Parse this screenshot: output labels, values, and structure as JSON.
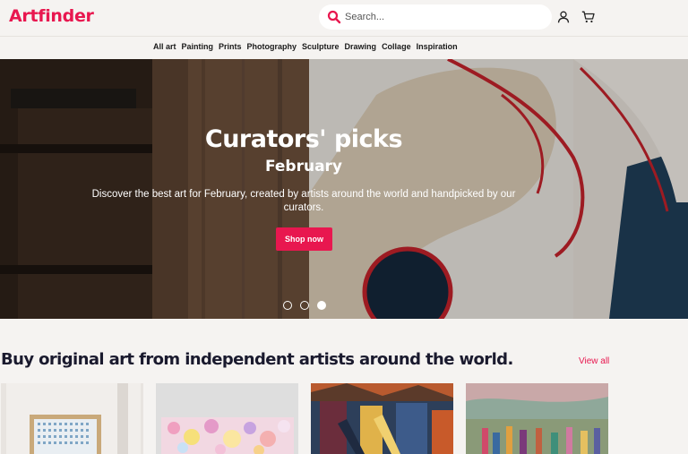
{
  "header": {
    "logo": "Artfinder",
    "search_placeholder": "Search...",
    "icons": [
      "search-icon",
      "user-icon",
      "cart-icon"
    ],
    "brand_color": "#e8174f"
  },
  "nav": {
    "items": [
      "All art",
      "Painting",
      "Prints",
      "Photography",
      "Sculpture",
      "Drawing",
      "Collage",
      "Inspiration"
    ]
  },
  "hero": {
    "title": "Curators' picks",
    "subtitle": "February",
    "description": "Discover the best art for February, created by artists around the world and handpicked by our curators.",
    "cta_label": "Shop now",
    "slides_count": 3,
    "active_slide": 3
  },
  "section": {
    "title": "Buy original art from independent artists around the world.",
    "view_all_label": "View all"
  }
}
